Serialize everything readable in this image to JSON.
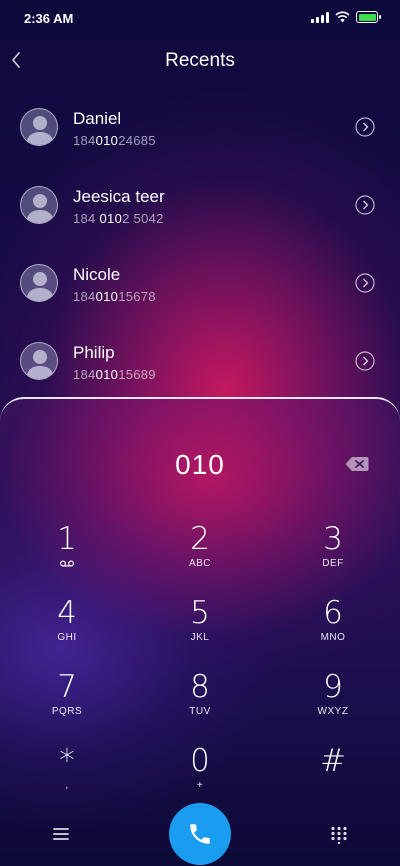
{
  "status_bar": {
    "time": "2:36 AM",
    "battery_level": 1.0,
    "battery_color": "#3fdc4f"
  },
  "header": {
    "title": "Recents",
    "back_icon": "chevron-left-icon"
  },
  "contacts": [
    {
      "name": "Daniel",
      "number_pre": "184",
      "number_match": "010",
      "number_post": "24685"
    },
    {
      "name": "Jeesica teer",
      "number_pre": "184 ",
      "number_match": "010",
      "number_post": "2 5042"
    },
    {
      "name": "Nicole",
      "number_pre": "184",
      "number_match": "010",
      "number_post": "15678"
    },
    {
      "name": "Philip",
      "number_pre": "184",
      "number_match": "010",
      "number_post": "15689"
    }
  ],
  "dialpad": {
    "input_value": "010",
    "keys": [
      {
        "digit": "1",
        "letters": ""
      },
      {
        "digit": "2",
        "letters": "ABC"
      },
      {
        "digit": "3",
        "letters": "DEF"
      },
      {
        "digit": "4",
        "letters": "GHI"
      },
      {
        "digit": "5",
        "letters": "JKL"
      },
      {
        "digit": "6",
        "letters": "MNO"
      },
      {
        "digit": "7",
        "letters": "PQRS"
      },
      {
        "digit": "8",
        "letters": "TUV"
      },
      {
        "digit": "9",
        "letters": "WXYZ"
      },
      {
        "digit": "*",
        "letters": ","
      },
      {
        "digit": "0",
        "letters": "+"
      },
      {
        "digit": "#",
        "letters": ""
      }
    ]
  },
  "bottom_bar": {
    "call_color": "#1a9cf0",
    "menu_icon": "hamburger-menu-icon",
    "call_icon": "phone-icon",
    "keypad_icon": "keypad-grid-icon"
  }
}
